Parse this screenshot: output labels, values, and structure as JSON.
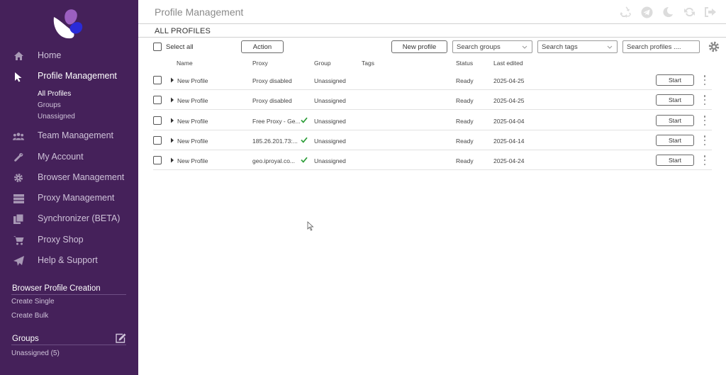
{
  "sidebar": {
    "nav": [
      {
        "label": "Home",
        "icon": "home-icon"
      },
      {
        "label": "Profile Management",
        "icon": "pointer-icon"
      },
      {
        "label": "Team Management",
        "icon": "team-icon"
      },
      {
        "label": "My Account",
        "icon": "wrench-icon"
      },
      {
        "label": "Browser Management",
        "icon": "gear-icon"
      },
      {
        "label": "Proxy Management",
        "icon": "server-icon"
      },
      {
        "label": "Synchronizer (BETA)",
        "icon": "copy-icon"
      },
      {
        "label": "Proxy Shop",
        "icon": "cart-icon"
      },
      {
        "label": "Help & Support",
        "icon": "paper-plane-icon"
      }
    ],
    "profile_sub": [
      "All Profiles",
      "Groups",
      "Unassigned"
    ],
    "creation": {
      "title": "Browser Profile Creation",
      "links": [
        "Create Single",
        "Create Bulk"
      ]
    },
    "groups": {
      "title": "Groups",
      "items": [
        "Unassigned (5)"
      ]
    }
  },
  "header": {
    "title": "Profile Management",
    "icons": [
      "recycle-icon",
      "telegram-icon",
      "moon-icon",
      "refresh-icon",
      "logout-icon"
    ]
  },
  "subheader": {
    "title": "ALL PROFILES"
  },
  "toolbar": {
    "select_all": "Select all",
    "action": "Action",
    "new_profile": "New profile",
    "search_groups": "Search groups",
    "search_tags": "Search tags",
    "search_profiles_placeholder": "Search profiles ...."
  },
  "table": {
    "columns": {
      "name": "Name",
      "proxy": "Proxy",
      "group": "Group",
      "tags": "Tags",
      "status": "Status",
      "last_edited": "Last edited"
    },
    "start_label": "Start",
    "rows": [
      {
        "name": "New Profile",
        "proxy": "Proxy disabled",
        "proxy_ok": false,
        "group": "Unassigned",
        "tags": "",
        "status": "Ready",
        "last_edited": "2025-04-25"
      },
      {
        "name": "New Profile",
        "proxy": "Proxy disabled",
        "proxy_ok": false,
        "group": "Unassigned",
        "tags": "",
        "status": "Ready",
        "last_edited": "2025-04-25"
      },
      {
        "name": "New Profile",
        "proxy": "Free Proxy - Ge...",
        "proxy_ok": true,
        "group": "Unassigned",
        "tags": "",
        "status": "Ready",
        "last_edited": "2025-04-04"
      },
      {
        "name": "New Profile",
        "proxy": "185.26.201.73:...",
        "proxy_ok": true,
        "group": "Unassigned",
        "tags": "",
        "status": "Ready",
        "last_edited": "2025-04-14"
      },
      {
        "name": "New Profile",
        "proxy": "geo.iproyal.co...",
        "proxy_ok": true,
        "group": "Unassigned",
        "tags": "",
        "status": "Ready",
        "last_edited": "2025-04-24"
      }
    ]
  },
  "colors": {
    "sidebar_bg": "#45215a",
    "check_green": "#2e9e3a",
    "logo_purple": "#9b5fc0",
    "logo_blue": "#2a2bd8"
  }
}
